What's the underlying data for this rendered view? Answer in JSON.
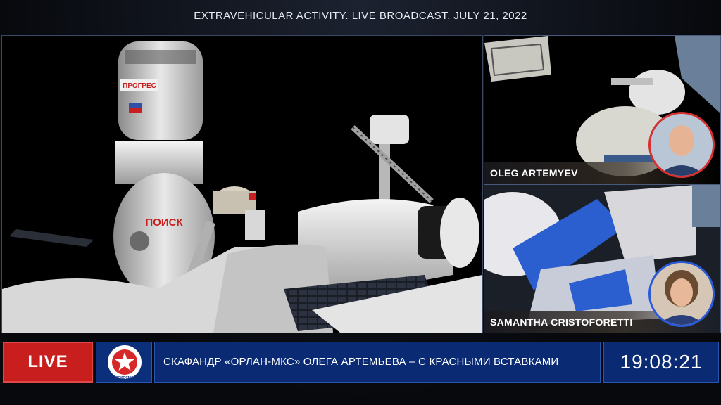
{
  "broadcast": {
    "title": "EXTRAVEHICULAR ACTIVITY.  LIVE BROADCAST.  JULY 21, 2022"
  },
  "cameras": [
    {
      "name": "OLEG ARTEMYEV",
      "accent": "#d63030"
    },
    {
      "name": "SAMANTHA CRISTOFORETTI",
      "accent": "#2a5ad8"
    }
  ],
  "hull_text": {
    "progress": "ПРОГРЕС",
    "poisk": "ПОИСК"
  },
  "bottom_bar": {
    "live_label": "LIVE",
    "logo_text": "РОСКОСМОС",
    "ticker": "СКАФАНДР «ОРЛАН-МКС» ОЛЕГА АРТЕМЬЕВА – С КРАСНЫМИ ВСТАВКАМИ",
    "clock": "19:08:21"
  },
  "colors": {
    "live": "#c81e1e",
    "bar": "#0a2b74",
    "border": "#2a55b0"
  }
}
